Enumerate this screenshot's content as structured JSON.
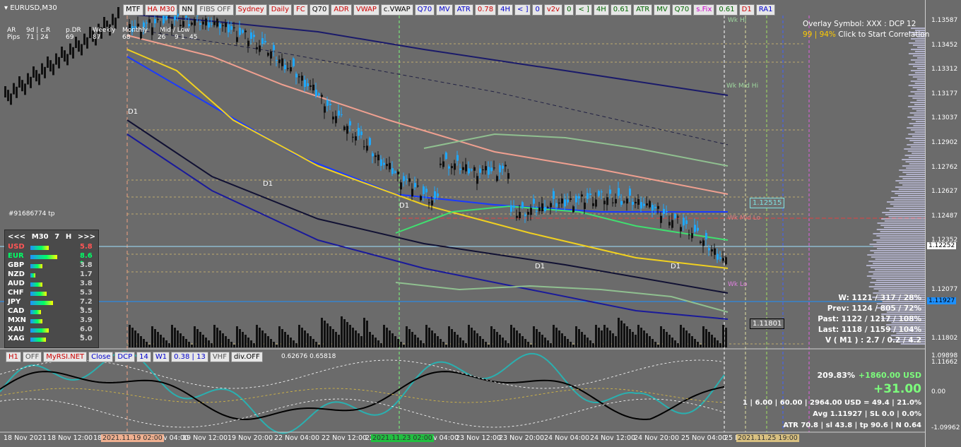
{
  "symbol": "EURUSD,M30",
  "top_toolbar": [
    {
      "label": "MTF",
      "color": "#000000"
    },
    {
      "label": "HA M30",
      "color": "#cc0000"
    },
    {
      "label": "NN",
      "color": "#000000"
    },
    {
      "label": "FIBS OFF",
      "color": "#555555"
    },
    {
      "label": "Sydney",
      "color": "#cc0000"
    },
    {
      "label": "Daily",
      "color": "#cc0000"
    },
    {
      "label": "FC",
      "color": "#cc0000"
    },
    {
      "label": "Q70",
      "color": "#000000"
    },
    {
      "label": "ADR",
      "color": "#cc0000"
    },
    {
      "label": "VWAP",
      "color": "#cc0000"
    },
    {
      "label": "c.VWAP",
      "color": "#000000"
    },
    {
      "label": "Q70",
      "color": "#0000cc"
    },
    {
      "label": "MV",
      "color": "#0000cc"
    },
    {
      "label": "ATR",
      "color": "#0000cc"
    },
    {
      "label": "0.78",
      "color": "#cc0000"
    },
    {
      "label": "4H",
      "color": "#0000cc"
    },
    {
      "label": "< ]",
      "color": "#0000cc"
    },
    {
      "label": "0",
      "color": "#0000cc"
    },
    {
      "label": "v2v",
      "color": "#cc0000"
    },
    {
      "label": "0",
      "color": "#006600"
    },
    {
      "label": "< ]",
      "color": "#006600"
    },
    {
      "label": "4H",
      "color": "#006600"
    },
    {
      "label": "0.61",
      "color": "#006600"
    },
    {
      "label": "ATR",
      "color": "#006600"
    },
    {
      "label": "MV",
      "color": "#006600"
    },
    {
      "label": "Q70",
      "color": "#006600"
    },
    {
      "label": "s.Fix",
      "color": "#cc00cc"
    },
    {
      "label": "0.61",
      "color": "#006600"
    },
    {
      "label": "D1",
      "color": "#cc0000"
    },
    {
      "label": "RA1",
      "color": "#0000cc"
    }
  ],
  "bottom_toolbar": [
    {
      "label": "H1",
      "color": "#cc0000"
    },
    {
      "label": "OFF",
      "color": "#555555"
    },
    {
      "label": "MyRSI.NET",
      "color": "#cc0000"
    },
    {
      "label": "Close",
      "color": "#0000cc"
    },
    {
      "label": "DCP",
      "color": "#0000cc"
    },
    {
      "label": "14",
      "color": "#0000cc"
    },
    {
      "label": "W1",
      "color": "#0000cc"
    },
    {
      "label": "0.38 | 13",
      "color": "#0000cc"
    },
    {
      "label": "VHF",
      "color": "#555555"
    },
    {
      "label": "div.OFF",
      "color": "#000000"
    }
  ],
  "indicator_values": "0.62676 0.65818",
  "header_stats": {
    "row1": [
      "AR",
      "9d | c.R",
      "p.DR",
      "Weekly",
      "Monthly",
      "Mid / Low"
    ],
    "row2": [
      "Pips",
      "71 | 24",
      "69",
      "87",
      "68",
      "26",
      "9",
      "1",
      "45"
    ]
  },
  "overlay": {
    "line1": "Overlay Symbol: XXX : DCP 12",
    "line2_pct": "99 | 94%",
    "line2_text": "Click to Start Correlation"
  },
  "chart_labels": {
    "wk_hi": "Wk Hi",
    "wk_mid_hi": "Wk Mid Hi",
    "wk_mid_lo": "Wk Mid Lo",
    "wk_lo": "Wk Lo",
    "d1": "D1",
    "ticket": "#91686774 tp",
    "box1": "1.12515",
    "box2": "1.11801"
  },
  "strength_meter": {
    "header": [
      "<<<",
      "M30",
      "7",
      "H",
      ">>>"
    ],
    "rows": [
      {
        "name": "USD",
        "value": "5.8",
        "color": "#ff5555",
        "fill": 0.58
      },
      {
        "name": "EUR",
        "value": "8.6 *",
        "color": "#00ff66",
        "fill": 0.86
      },
      {
        "name": "GBP",
        "value": "3.8",
        "color": "#ffffff",
        "fill": 0.38
      },
      {
        "name": "NZD",
        "value": "1.7",
        "color": "#ffffff",
        "fill": 0.17
      },
      {
        "name": "AUD",
        "value": "3.8",
        "color": "#ffffff",
        "fill": 0.38
      },
      {
        "name": "CHF",
        "value": "5.3",
        "color": "#ffffff",
        "fill": 0.53
      },
      {
        "name": "JPY",
        "value": "7.2 *",
        "color": "#ffffff",
        "fill": 0.72
      },
      {
        "name": "CAD",
        "value": "3.5",
        "color": "#ffffff",
        "fill": 0.35
      },
      {
        "name": "MXN",
        "value": "3.9",
        "color": "#ffffff",
        "fill": 0.39
      },
      {
        "name": "XAU",
        "value": "6.0 *",
        "color": "#ffffff",
        "fill": 0.6
      },
      {
        "name": "XAG",
        "value": "5.0",
        "color": "#ffffff",
        "fill": 0.5
      }
    ]
  },
  "stats_panel": [
    "W: 1121 / 317 / 28%",
    "Prev: 1124 / 805 / 72%",
    "Past: 1122 / 1217 / 108%",
    "Last: 1118 / 1159 / 104%",
    "V ( M1 ) : 2.7 / 0.2 / 4.2"
  ],
  "pnl": {
    "pct": "209.83%",
    "usd": "+1860.00 USD",
    "pips": "+31.00"
  },
  "trade_info": [
    "1  |  6.00  |  60.00  |  2964.00 USD = 49.4  |  21.0%",
    "Avg 1.11927  |  SL 0.0  |  0.0%",
    "ATR 70.8  |  sl 43.8  |  tp 90.6  |  N 0.64"
  ],
  "price_axis": [
    "1.13587",
    "1.13452",
    "1.13312",
    "1.13177",
    "1.13037",
    "1.12902",
    "1.12762",
    "1.12627",
    "1.12487",
    "1.12352",
    "1.12252",
    "1.12077",
    "1.11927",
    "1.11802",
    "1.11662"
  ],
  "price_axis_highlight": {
    "1.12252": "#ffffff",
    "1.11927": "#1e90ff"
  },
  "osc_axis": [
    "1.09898",
    "0.00",
    "-1.09962"
  ],
  "time_axis": [
    "18 Nov 2021",
    "18 Nov 12:00",
    "18 N",
    "2021.11.19 02:00",
    "v 04:00",
    "19 Nov 12:00",
    "19 Nov 20:00",
    "22 Nov 04:00",
    "22 Nov 12:00",
    "22",
    "2021.11.23 02:00",
    "v 04:00",
    "23 Nov 12:00",
    "23 Nov 20:00",
    "24 Nov 04:00",
    "24 Nov 12:00",
    "24 Nov 20:00",
    "25 Nov 04:00",
    "25 N",
    "2021.11.25 19:00"
  ],
  "time_axis_highlight": {
    "2021.11.19 02:00": "#f0b090",
    "2021.11.23 02:00": "#20c040",
    "2021.11.25 19:00": "#d8c080"
  }
}
